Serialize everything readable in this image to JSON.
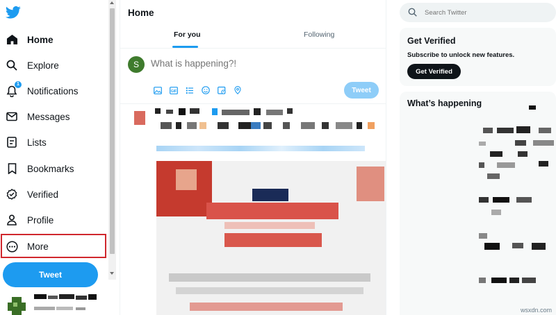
{
  "sidebar": {
    "logo_icon": "twitter-bird-icon",
    "items": [
      {
        "label": "Home",
        "icon": "home-icon",
        "active": true
      },
      {
        "label": "Explore",
        "icon": "search-icon"
      },
      {
        "label": "Notifications",
        "icon": "bell-icon",
        "badge": "1"
      },
      {
        "label": "Messages",
        "icon": "envelope-icon"
      },
      {
        "label": "Lists",
        "icon": "list-icon"
      },
      {
        "label": "Bookmarks",
        "icon": "bookmark-icon"
      },
      {
        "label": "Verified",
        "icon": "verified-icon"
      },
      {
        "label": "Profile",
        "icon": "person-icon"
      },
      {
        "label": "More",
        "icon": "more-circle-icon",
        "highlighted": true
      }
    ],
    "tweet_button": "Tweet"
  },
  "main": {
    "title": "Home",
    "tabs": [
      {
        "label": "For you",
        "selected": true
      },
      {
        "label": "Following",
        "selected": false
      }
    ],
    "compose": {
      "avatar_letter": "S",
      "placeholder": "What is happening?!",
      "tools": [
        "image-icon",
        "gif-icon",
        "poll-icon",
        "emoji-icon",
        "schedule-icon",
        "location-icon"
      ],
      "post_button": "Tweet"
    }
  },
  "right": {
    "search_placeholder": "Search Twitter",
    "verified": {
      "title": "Get Verified",
      "subtitle": "Subscribe to unlock new features.",
      "button": "Get Verified"
    },
    "happening_title": "What’s happening"
  },
  "watermark": "wsxdn.com",
  "colors": {
    "accent": "#1d9bf0",
    "highlight_box": "#d0272d",
    "avatar": "#3f7b2d"
  }
}
